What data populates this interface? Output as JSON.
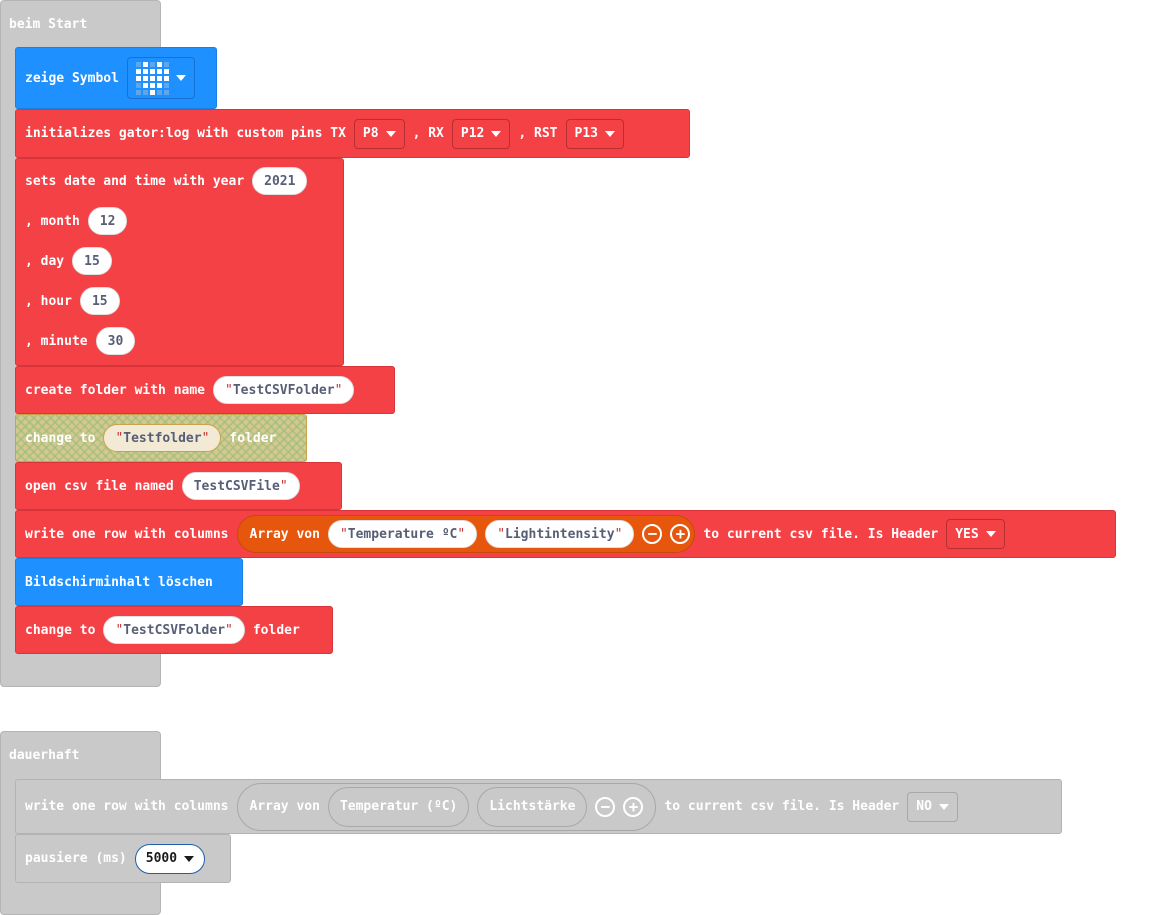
{
  "start_event": {
    "label": "beim Start",
    "show_icon": {
      "label": "zeige Symbol",
      "icon": "heart-icon",
      "grid": [
        [
          0,
          1,
          0,
          1,
          0
        ],
        [
          1,
          1,
          1,
          1,
          1
        ],
        [
          1,
          1,
          1,
          1,
          1
        ],
        [
          0,
          1,
          1,
          1,
          0
        ],
        [
          0,
          0,
          1,
          0,
          0
        ]
      ]
    },
    "init": {
      "label": "initializes gator:log with custom pins TX",
      "tx": "P8",
      "rx_label": ", RX",
      "rx": "P12",
      "rst_label": ", RST",
      "rst": "P13"
    },
    "datetime": {
      "label": "sets date and time with year",
      "year": "2021",
      "month_label": ", month",
      "month": "12",
      "day_label": ", day",
      "day": "15",
      "hour_label": ", hour",
      "hour": "15",
      "minute_label": ", minute",
      "minute": "30"
    },
    "create_folder": {
      "label": "create folder with name",
      "name": "TestCSVFolder"
    },
    "change_disabled": {
      "label": "change to",
      "name": "Testfolder",
      "suffix": "folder"
    },
    "open_csv": {
      "label": "open csv file named",
      "name": "TestCSVFile"
    },
    "write_row": {
      "label": "write one row with columns",
      "array_label": "Array von",
      "col1": "Temperature ºC",
      "col2": "Lightintensity",
      "suffix": "to current csv file. Is Header",
      "header": "YES"
    },
    "clear_screen": {
      "label": "Bildschirminhalt löschen"
    },
    "change_folder": {
      "label": "change to",
      "name": "TestCSVFolder",
      "suffix": "folder"
    }
  },
  "forever_event": {
    "label": "dauerhaft",
    "write_row": {
      "label": "write one row with columns",
      "array_label": "Array von",
      "col1": "Temperatur (ºC)",
      "col2": "Lichtstärke",
      "suffix": "to current csv file. Is Header",
      "header": "NO"
    },
    "pause": {
      "label": "pausiere (ms)",
      "value": "5000"
    }
  },
  "colors": {
    "red_block": "#f44146",
    "blue_block": "#1e90ff",
    "gray_block": "#c9c9c9",
    "array_block": "#e6570d"
  }
}
